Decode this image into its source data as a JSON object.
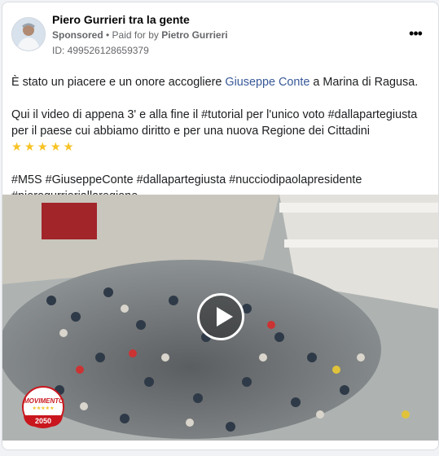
{
  "post": {
    "page_name": "Piero Gurrieri tra la gente",
    "sponsored_label": "Sponsored",
    "paid_for_prefix": " • Paid for by ",
    "paid_for_name": "Pietro Gurrieri",
    "ad_id": "ID: 499526128659379",
    "more_label": "•••",
    "text": {
      "p1_before": "È stato un piacere e un onore accogliere ",
      "p1_link": "Giuseppe Conte",
      "p1_after": " a Marina di Ragusa.",
      "p2": "Qui il video di appena 3' e alla fine il #tutorial per l'unico voto #dallapartegiusta per il paese cui abbiamo diritto e per una nuova Regione dei Cittadini",
      "p2_stars": "★★★★★",
      "p3": "#M5S #GiuseppeConte #dallapartegiusta #nucciodipaolapresidente #pierogurrieriallaregione"
    },
    "video": {
      "logo_top": "MOVIMENTO",
      "logo_stars": "★★★★★",
      "logo_year": "2050"
    }
  },
  "colors": {
    "link": "#385898",
    "text": "#1c1e21",
    "secondary": "#65676b",
    "stars": "#f7c325"
  }
}
